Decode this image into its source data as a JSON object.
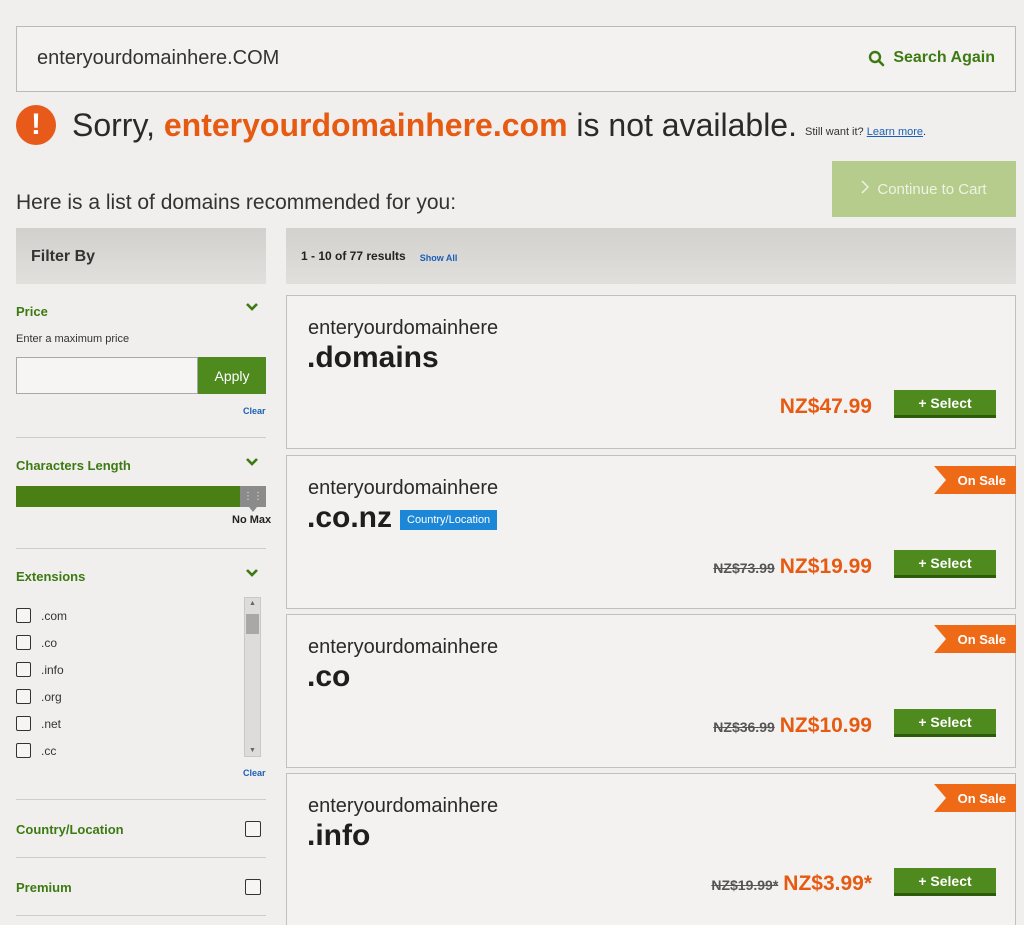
{
  "search": {
    "value": "enteryourdomainhere.COM",
    "again_label": "Search Again"
  },
  "availability": {
    "sorry_prefix": "Sorry,",
    "domain": "enteryourdomainhere.com",
    "suffix": "is not available.",
    "still_want": "Still want it?",
    "learn_more": "Learn more",
    "period": "."
  },
  "recommend_heading": "Here is a list of domains recommended for you:",
  "continue_label": "Continue to Cart",
  "filter": {
    "title": "Filter By",
    "price": {
      "title": "Price",
      "hint": "Enter a maximum price",
      "apply": "Apply",
      "clear": "Clear"
    },
    "length": {
      "title": "Characters Length",
      "max_label": "No Max"
    },
    "extensions": {
      "title": "Extensions",
      "items": [
        ".com",
        ".co",
        ".info",
        ".org",
        ".net",
        ".cc"
      ],
      "clear": "Clear"
    },
    "country": "Country/Location",
    "premium": "Premium"
  },
  "results": {
    "count": "1 - 10 of 77 results",
    "show_all": "Show All",
    "items": [
      {
        "name": "enteryourdomainhere",
        "ext": ".domains",
        "price": "NZ$47.99",
        "old_price": "",
        "on_sale": false,
        "tag": ""
      },
      {
        "name": "enteryourdomainhere",
        "ext": ".co.nz",
        "price": "NZ$19.99",
        "old_price": "NZ$73.99",
        "on_sale": true,
        "tag": "Country/Location"
      },
      {
        "name": "enteryourdomainhere",
        "ext": ".co",
        "price": "NZ$10.99",
        "old_price": "NZ$36.99",
        "on_sale": true,
        "tag": ""
      },
      {
        "name": "enteryourdomainhere",
        "ext": ".info",
        "price": "NZ$3.99*",
        "old_price": "NZ$19.99*",
        "on_sale": true,
        "tag": ""
      }
    ],
    "select_label": "+ Select",
    "sale_label": "On Sale"
  },
  "colors": {
    "accent_green": "#4e8a1e",
    "accent_orange": "#e65a12",
    "link_blue": "#1a5fb4"
  }
}
